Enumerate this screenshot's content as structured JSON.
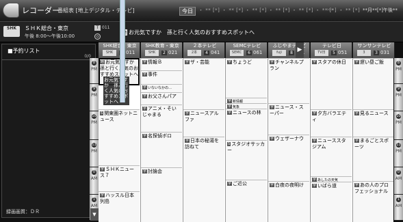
{
  "topbar": {
    "app_title": "レコーダー",
    "breadcrumb": "番組表 [地上デジタル・テレビ]",
    "today_label": "今日",
    "dates_strip": "・ ** [*] ・ ** [*] ・ ** [*] ・ ** [*] ・ ** [*] ・ ** [*] ・ ** [*]",
    "arrows": "›››",
    "date_right": "**月**[*]午後**"
  },
  "infobar": {
    "logo": "SHK",
    "channel": "ＳＨＫ総合・東京",
    "time_range": "午後 8:00〜午後10:00",
    "channel_number": "011",
    "program_tag": "題",
    "program_title": "お元気ですか　孫と行く人気のおすすめスポットへ"
  },
  "reserve_list": {
    "title": "■予約リスト",
    "count": "0/0",
    "footer": "録画画質：ＤＲ"
  },
  "channels": [
    {
      "name": "SHK総合・東京",
      "icon": "SHK",
      "num": "011",
      "numTag": "1"
    },
    {
      "name": "SHK教育・東京",
      "icon": "SHK",
      "num": "021",
      "numTag": "2"
    },
    {
      "name": "２本テレビ",
      "icon": "2本",
      "num": "041",
      "numTag": "4"
    },
    {
      "name": "SEMCテレビ",
      "icon": "SEMC",
      "num": "061",
      "numTag": "6"
    },
    {
      "name": "ふじやまテレビ",
      "icon": "fuji",
      "num": "081",
      "numTag": "8"
    },
    {
      "name": "テレビ日",
      "icon": "TV日",
      "num": "051",
      "numTag": "5"
    },
    {
      "name": "サンサンテレビ",
      "icon": "3",
      "num": "031",
      "numTag": "3"
    }
  ],
  "hours": [
    {
      "num": "8",
      "ap": "PM"
    },
    {
      "num": "9",
      "ap": "PM"
    },
    {
      "num": "10",
      "ap": "PM"
    },
    {
      "num": "11",
      "ap": "PM"
    },
    {
      "num": "0",
      "ap": "AM"
    },
    {
      "num": "1",
      "ap": "AM"
    }
  ],
  "programs": [
    {
      "col": 0,
      "tag": "題",
      "title": "お元気ですか　孫と行く人気のおすすめスポットへ",
      "selected": true
    },
    {
      "col": 0,
      "tag": "S",
      "title": "関東圏ネットニュース"
    },
    {
      "col": 0,
      "tag": "字",
      "title": "ＳＨＫニュース７"
    },
    {
      "col": 0,
      "tag": "字",
      "title": "ハッスル日本列島"
    },
    {
      "col": 1,
      "tag": "字",
      "title": "情報Ｂ"
    },
    {
      "col": 1,
      "tag": "字",
      "title": "事件"
    },
    {
      "col": 1,
      "tag": "字",
      "title": "いないなかの…"
    },
    {
      "col": 1,
      "tag": "字",
      "title": "お父さんパア"
    },
    {
      "col": 1,
      "tag": "字",
      "title": "アニメ・そいじゃまる"
    },
    {
      "col": 1,
      "tag": "字",
      "title": "名探偵ボロ"
    },
    {
      "col": 1,
      "tag": "字",
      "title": "討論会"
    },
    {
      "col": 2,
      "tag": "字",
      "title": "ザ・芸能"
    },
    {
      "col": 2,
      "tag": "字",
      "title": "ニュースアルファ"
    },
    {
      "col": 2,
      "tag": "字",
      "title": "日本の秘湯を訪ねて"
    },
    {
      "col": 3,
      "tag": "字",
      "title": "ちょうど"
    },
    {
      "col": 3,
      "tag": "字",
      "title": "新情報"
    },
    {
      "col": 3,
      "tag": "字",
      "title": "気象"
    },
    {
      "col": 3,
      "tag": "字",
      "title": "ニュースの林"
    },
    {
      "col": 3,
      "tag": "S",
      "title": "スタジオサッカー"
    },
    {
      "col": 3,
      "tag": "字",
      "title": "ご近公"
    },
    {
      "col": 4,
      "tag": "字",
      "title": "チャンネルプラン"
    },
    {
      "col": 4,
      "tag": "字",
      "title": "ニュース・スーパー"
    },
    {
      "col": 4,
      "tag": "字",
      "title": "ウェザーナウ"
    },
    {
      "col": 4,
      "tag": "字",
      "title": "白夜の夜明け"
    },
    {
      "col": 5,
      "tag": "字",
      "title": "スタアの休日"
    },
    {
      "col": 5,
      "tag": "字",
      "title": "夕方バラエティ"
    },
    {
      "col": 5,
      "tag": "字",
      "title": "ニューススタジアム"
    },
    {
      "col": 5,
      "tag": "字",
      "title": "あしたの天気"
    },
    {
      "col": 5,
      "tag": "字",
      "title": "いばら道"
    },
    {
      "col": 6,
      "tag": "字",
      "title": "遅い昼ご飯"
    },
    {
      "col": 6,
      "tag": "字",
      "title": "見るニュース"
    },
    {
      "col": 6,
      "tag": "字",
      "title": "まるごとスポーツ"
    },
    {
      "col": 6,
      "tag": "字",
      "title": "あの人のプロフェッショナル"
    }
  ],
  "scroll": {
    "down_label": "▼",
    "next_label": "▶"
  }
}
